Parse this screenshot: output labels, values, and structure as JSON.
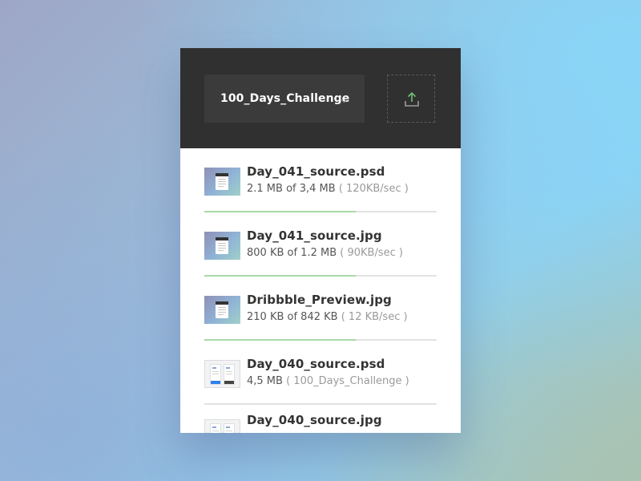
{
  "header": {
    "folder_label": "100_Days_Challenge",
    "upload_icon": "upload-arrow-icon",
    "upload_icon_color": "#6fbf73"
  },
  "files": [
    {
      "name": "Day_041_source.psd",
      "size": "2.1 MB of 3,4 MB",
      "extra": "( 120KB/sec )",
      "progress": 0.65,
      "thumb": "photo",
      "uploading": true
    },
    {
      "name": "Day_041_source.jpg",
      "size": "800 KB of 1.2 MB",
      "extra": "( 90KB/sec )",
      "progress": 0.65,
      "thumb": "photo",
      "uploading": true
    },
    {
      "name": "Dribbble_Preview.jpg",
      "size": "210 KB of 842 KB",
      "extra": "( 12 KB/sec )",
      "progress": 0.65,
      "thumb": "photo",
      "uploading": true
    },
    {
      "name": "Day_040_source.psd",
      "size": "4,5 MB",
      "extra": "( 100_Days_Challenge )",
      "progress": 0,
      "thumb": "screenshot",
      "uploading": false
    },
    {
      "name": "Day_040_source.jpg",
      "size": "",
      "extra": "",
      "progress": 0,
      "thumb": "screenshot",
      "uploading": false
    }
  ],
  "colors": {
    "header_bg": "#303030",
    "progress": "#a9d8a9",
    "track": "#e2e2e2"
  }
}
